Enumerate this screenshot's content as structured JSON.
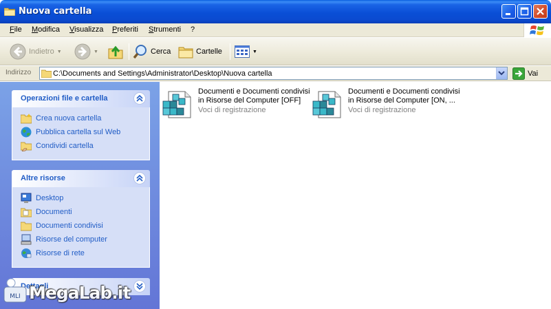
{
  "window": {
    "title": "Nuova cartella"
  },
  "menu": {
    "items": [
      "File",
      "Modifica",
      "Visualizza",
      "Preferiti",
      "Strumenti",
      "?"
    ]
  },
  "toolbar": {
    "back_label": "Indietro",
    "search_label": "Cerca",
    "folders_label": "Cartelle"
  },
  "address": {
    "label": "Indirizzo",
    "path": "C:\\Documents and Settings\\Administrator\\Desktop\\Nuova cartella",
    "go_label": "Vai"
  },
  "taskpane": {
    "panels": [
      {
        "title": "Operazioni file e cartella",
        "links": [
          "Crea nuova cartella",
          "Pubblica cartella sul Web",
          "Condividi cartella"
        ]
      },
      {
        "title": "Altre risorse",
        "links": [
          "Desktop",
          "Documenti",
          "Documenti condivisi",
          "Risorse del computer",
          "Risorse di rete"
        ]
      },
      {
        "title": "Dettagli"
      }
    ]
  },
  "files": [
    {
      "name_line1": "Documenti e Documenti condivisi",
      "name_line2": "in Risorse del Computer [OFF]",
      "type": "Voci di registrazione"
    },
    {
      "name_line1": "Documenti e Documenti condivisi",
      "name_line2": "in Risorse del Computer [ON, ...",
      "type": "Voci di registrazione"
    }
  ],
  "watermark": {
    "text": "MegaLab.it",
    "badge": "MLI"
  }
}
